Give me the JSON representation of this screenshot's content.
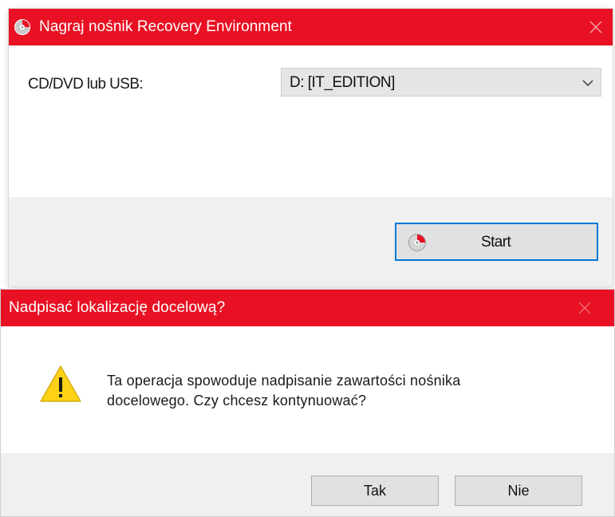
{
  "colors": {
    "titlebar": "#e81123",
    "focus_border": "#0078d7",
    "footer": "#f0f0f0"
  },
  "recovery_dialog": {
    "title": "Nagraj nośnik Recovery Environment",
    "icon": "recovery-disc-icon",
    "close_icon": "close-icon",
    "media_label": "CD/DVD lub USB:",
    "media_select": {
      "value": "D: [IT_EDITION]",
      "icon": "chevron-down-icon"
    },
    "start_button": {
      "label": "Start",
      "icon": "recovery-disc-icon"
    }
  },
  "confirm_dialog": {
    "title": "Nadpisać lokalizację docelową?",
    "close_icon": "close-icon",
    "warning_icon": "warning-icon",
    "message_line1": "Ta operacja spowoduje nadpisanie zawartości nośnika",
    "message_line2": "docelowego. Czy chcesz kontynuować?",
    "yes_label": "Tak",
    "no_label": "Nie"
  }
}
